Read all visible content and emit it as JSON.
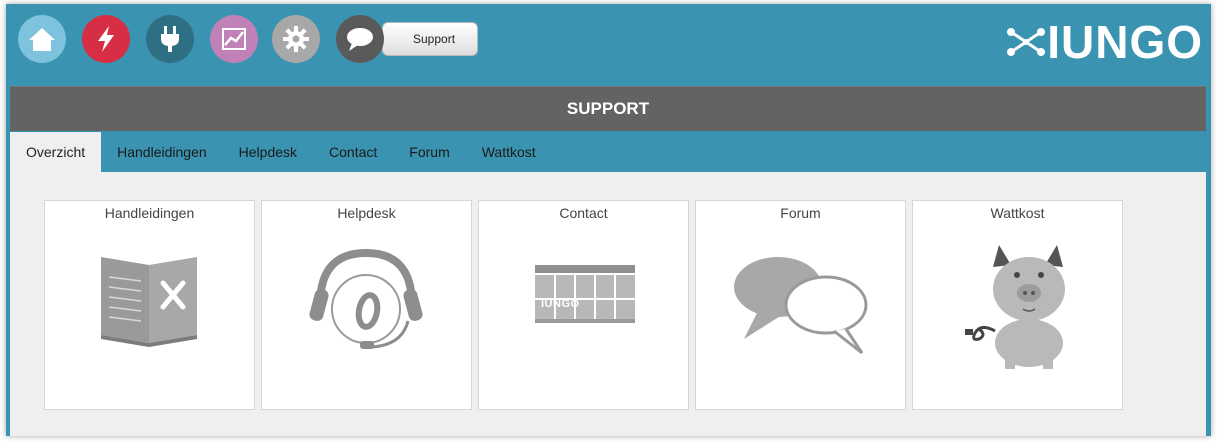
{
  "topbar": {
    "icons": [
      {
        "name": "home-icon",
        "color": "#7ec3de"
      },
      {
        "name": "lightning-icon",
        "color": "#d62f45"
      },
      {
        "name": "plug-icon",
        "color": "#2f6f84"
      },
      {
        "name": "chart-icon",
        "color": "#c080b8"
      },
      {
        "name": "gear-icon",
        "color": "#a8a8a8"
      },
      {
        "name": "chat-icon",
        "color": "#5a5a5a"
      }
    ],
    "support_label": "Support",
    "logo_text": "IUNGO"
  },
  "header": {
    "title": "SUPPORT"
  },
  "tabs": [
    {
      "label": "Overzicht",
      "active": true
    },
    {
      "label": "Handleidingen",
      "active": false
    },
    {
      "label": "Helpdesk",
      "active": false
    },
    {
      "label": "Contact",
      "active": false
    },
    {
      "label": "Forum",
      "active": false
    },
    {
      "label": "Wattkost",
      "active": false
    }
  ],
  "cards": [
    {
      "title": "Handleidingen",
      "icon": "manual-book-icon"
    },
    {
      "title": "Helpdesk",
      "icon": "headset-icon"
    },
    {
      "title": "Contact",
      "icon": "iungo-device-icon",
      "device_label": "IUNGO"
    },
    {
      "title": "Forum",
      "icon": "speech-bubbles-icon"
    },
    {
      "title": "Wattkost",
      "icon": "piggy-bank-icon"
    }
  ],
  "colors": {
    "frame": "#3a93b0",
    "header": "#636363",
    "content_bg": "#efefef"
  }
}
